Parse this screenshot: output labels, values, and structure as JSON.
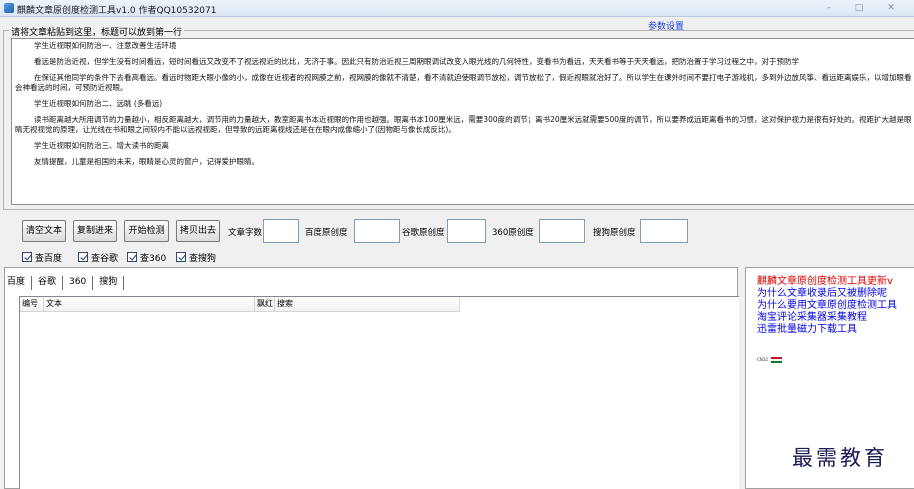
{
  "window": {
    "title": "麒麟文章原创度检测工具v1.0 作者QQ10532071",
    "controls": [
      "–",
      "□",
      "✕"
    ]
  },
  "settings_link": "参数设置",
  "article_group": {
    "legend": "请将文章粘贴到这里，标题可以放到第一行",
    "paragraphs": [
      {
        "kind": "head",
        "text": "学生近视眼如何防治一、注意改善生活环境"
      },
      {
        "kind": "para",
        "text": "看远是防治近视，但学生没有时间看远，短时间看远又改变不了视远视近的比比，无济于事。因此只有防治近视三周期眼调试改变入眼光线的几何特性，变看书为看远，天天看书等于天天看远，把防治置于学习过程之中，对于预防学"
      },
      {
        "kind": "para",
        "text": "在保证其他同学的条件下去看高看远。看远时物距大眼小像的小，成像在近视者的视网膜之前，视网膜的像就不清楚，看不清就迫使眼调节放松，调节放松了，假近视眼就治好了。所以学生在课外时间不要打电子游戏机，多到外边放风筝、看远距离娱乐，以增加眼看会神看远的时间，可预防近视眼。"
      },
      {
        "kind": "head",
        "text": "学生近视眼如何防治二、远眺 (多看远)"
      },
      {
        "kind": "para",
        "text": "读书距离越大所用调节的力量越小，相反距离越大，调节用的力量越大，教室距离书本近视眼的作用也越强。眼离书本100厘米远，需要300度的调节；离书20厘米远就需要500度的调节，所以要养成远距离看书的习惯，这对保护视力是很有好处的。视距扩大越是眼睛无视视觉的原理，让光线在书和眼之间较内不能以远视视距，但导致的远距离视线还是在在眼内成像缩小了(因物距与像长成反比)。"
      },
      {
        "kind": "head",
        "text": "学生近视眼如何防治三、增大读书的距离"
      },
      {
        "kind": "head",
        "text": "友情提醒，儿童是祖国的未来，眼睛是心灵的窗户，记得爱护眼睛。"
      }
    ]
  },
  "toolbar": {
    "clear_label": "清空文本",
    "copy_back_label": "复制进来",
    "start_label": "开始检测",
    "copy_out_label": "拷贝出去",
    "word_count_label": "文章字数",
    "word_count_value": "",
    "baidu_orig_label": "百度原创度",
    "baidu_orig_value": "",
    "google_orig_label": "谷歌原创度",
    "google_orig_value": "",
    "s360_orig_label": "360原创度",
    "s360_orig_value": "",
    "sogou_orig_label": "搜狗原创度",
    "sogou_orig_value": ""
  },
  "checks": [
    {
      "label": "查百度",
      "checked": true
    },
    {
      "label": "查谷歌",
      "checked": true
    },
    {
      "label": "查360",
      "checked": true
    },
    {
      "label": "查搜狗",
      "checked": true
    }
  ],
  "result_tabs": [
    "百度",
    "谷歌",
    "360",
    "搜狗"
  ],
  "grid_columns": [
    "编号",
    "文本",
    "飘红",
    "搜索"
  ],
  "side_links": [
    {
      "text": "麒麟文章原创度检测工具更新v",
      "color": "red"
    },
    {
      "text": "为什么文章收录后又被删除呢",
      "color": "blue"
    },
    {
      "text": "为什么要用文章原创度检测工具",
      "color": "blue"
    },
    {
      "text": "淘宝评论采集器采集教程",
      "color": "blue"
    },
    {
      "text": "迅雷批量磁力下载工具",
      "color": "blue"
    }
  ],
  "lang_badge": "CN32",
  "watermark": "最需教育"
}
